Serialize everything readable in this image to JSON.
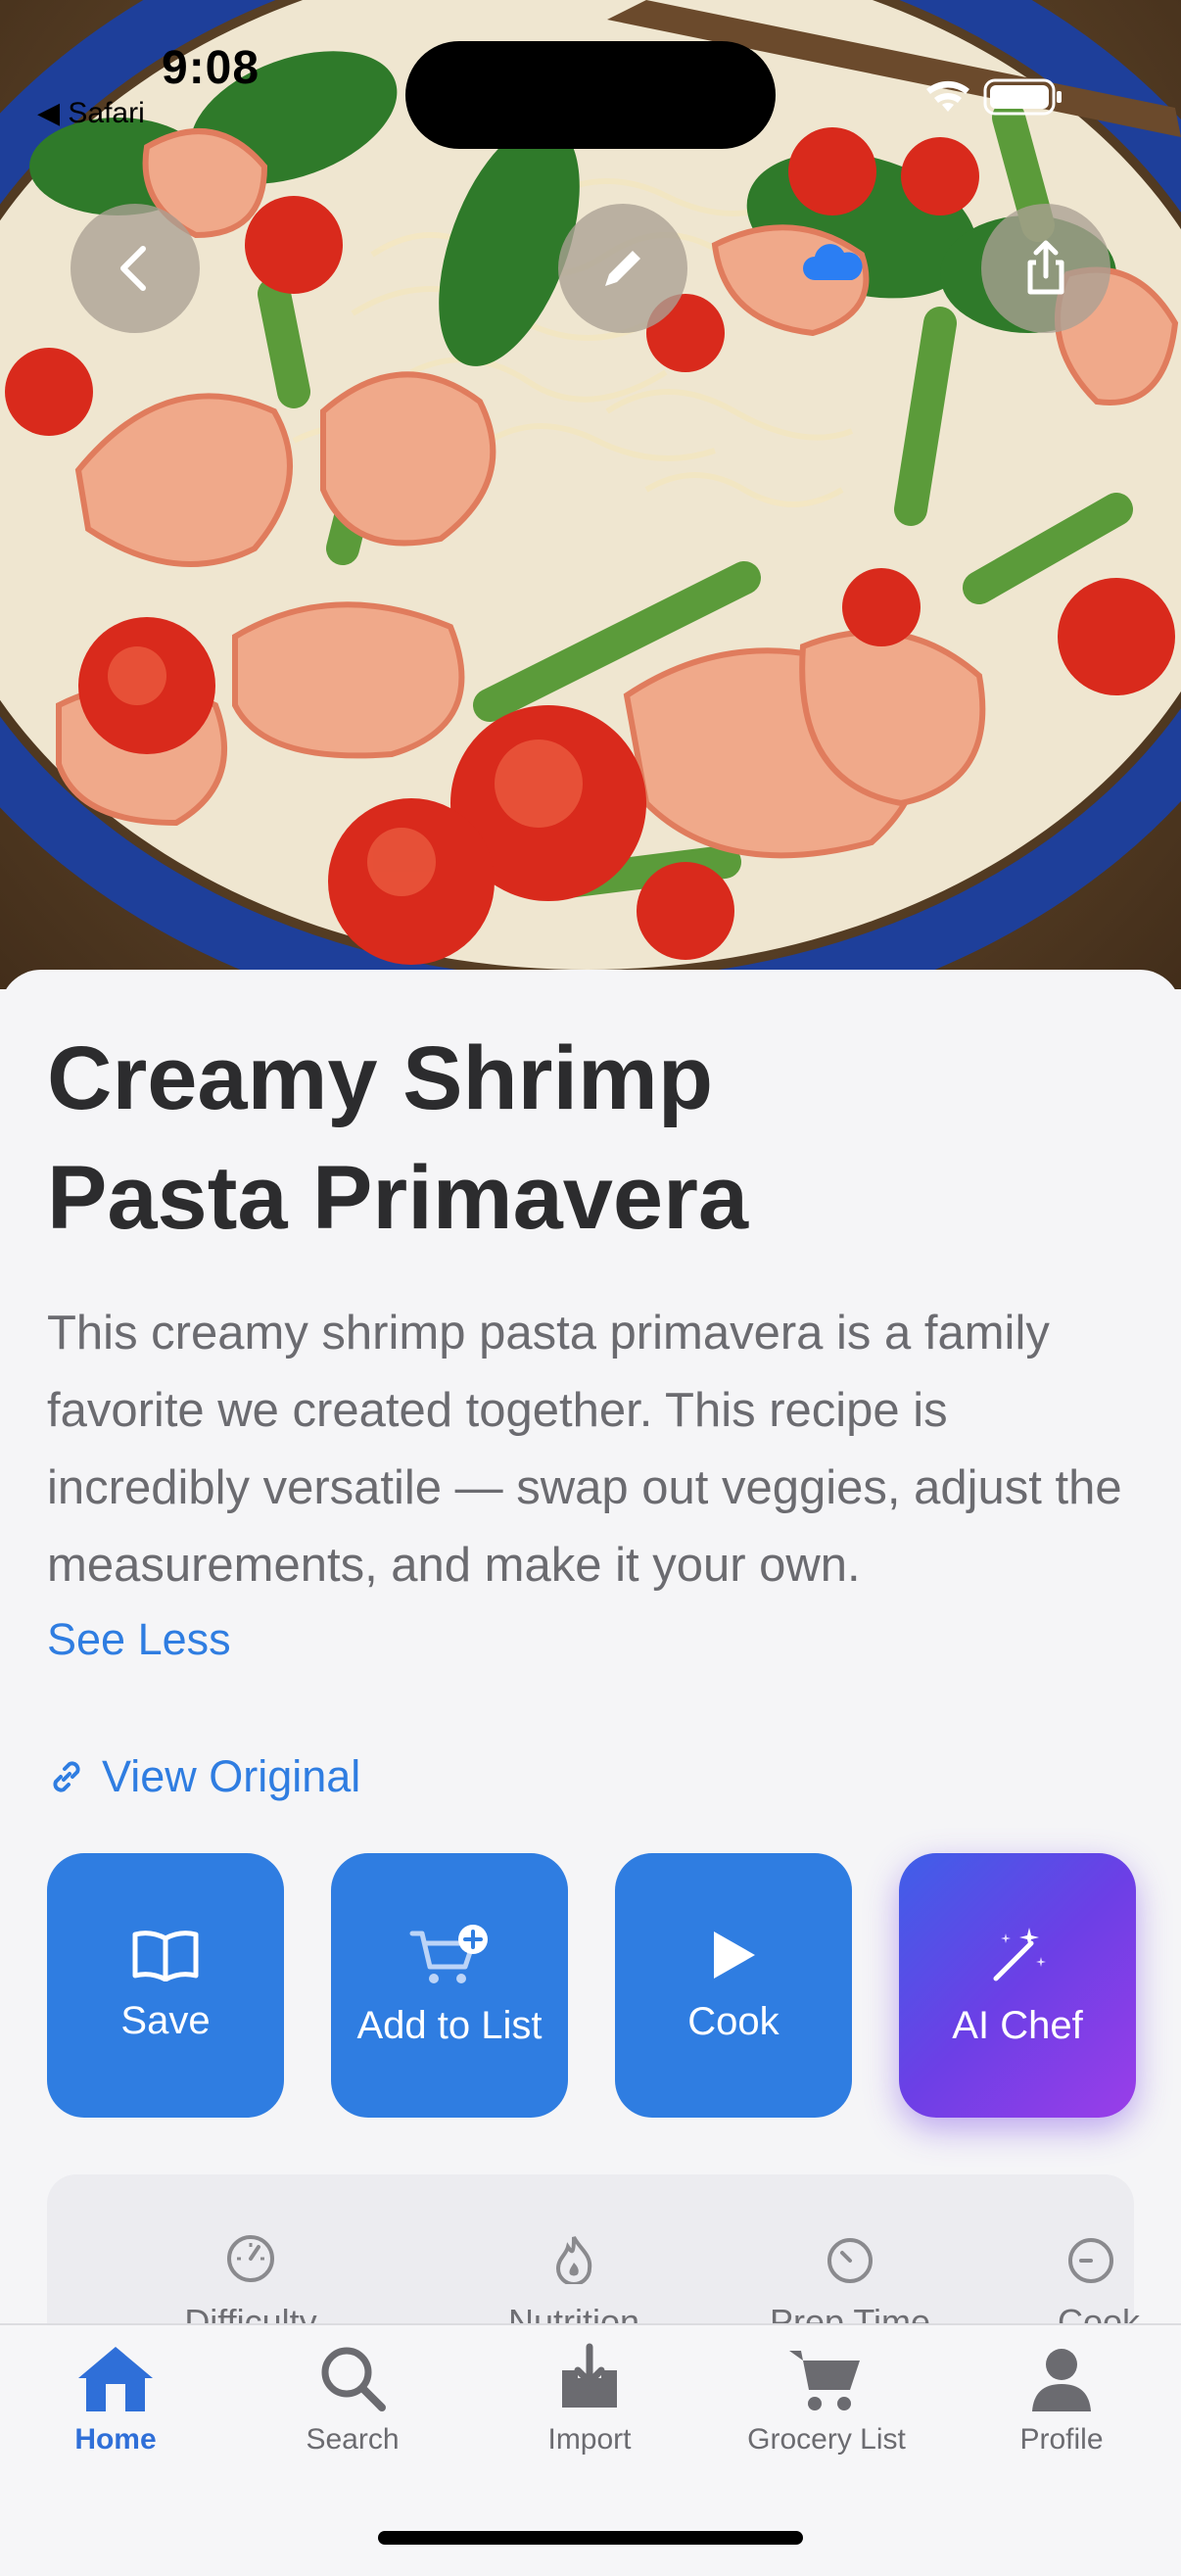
{
  "status": {
    "time": "9:08",
    "back_app": "◀ Safari"
  },
  "recipe": {
    "title_line1": "Creamy Shrimp",
    "title_line2": "Pasta Primavera",
    "description": "This creamy shrimp pasta primavera is a family favorite we created together. This recipe is incredibly versatile — swap out veggies, adjust the measurements, and make it your own.",
    "see_less": "See Less",
    "view_original": "View Original"
  },
  "actions": [
    {
      "label": "Save",
      "icon": "book-icon"
    },
    {
      "label": "Add to List",
      "icon": "cart-plus-icon"
    },
    {
      "label": "Cook",
      "icon": "play-icon"
    },
    {
      "label": "AI Chef",
      "icon": "magic-wand-icon"
    }
  ],
  "stats": [
    {
      "label": "Difficulty",
      "icon": "gauge-icon"
    },
    {
      "label": "Nutrition",
      "icon": "flame-icon"
    },
    {
      "label": "Prep Time",
      "icon": "timer-icon"
    },
    {
      "label": "Cook",
      "icon": "timer-icon"
    }
  ],
  "tabs": [
    {
      "label": "Home",
      "icon": "house-icon",
      "active": true
    },
    {
      "label": "Search",
      "icon": "magnifier-icon"
    },
    {
      "label": "Import",
      "icon": "tray-download-icon"
    },
    {
      "label": "Grocery List",
      "icon": "cart-icon"
    },
    {
      "label": "Profile",
      "icon": "person-icon"
    }
  ],
  "colors": {
    "accent": "#2f7de1",
    "ai_gradient_start": "#3f5fe8",
    "ai_gradient_end": "#9a3ee8",
    "tab_active": "#2f6fd8"
  }
}
